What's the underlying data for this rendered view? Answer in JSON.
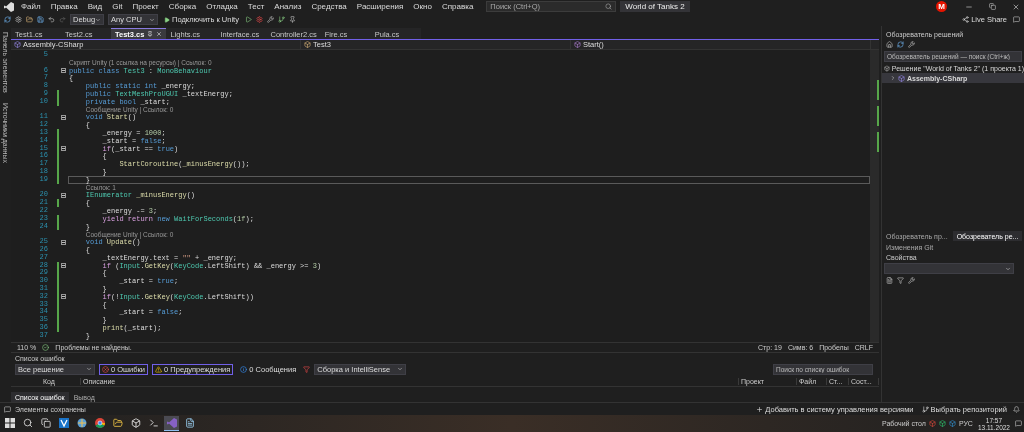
{
  "menu": {
    "items": [
      "Файл",
      "Правка",
      "Вид",
      "Git",
      "Проект",
      "Сборка",
      "Отладка",
      "Тест",
      "Анализ",
      "Средства",
      "Расширения",
      "Окно",
      "Справка"
    ]
  },
  "search": {
    "placeholder": "Поиск (Ctrl+Q)"
  },
  "solution_title": "World of Tanks 2",
  "account": {
    "initial": "M"
  },
  "toolbar": {
    "configuration": "Debug",
    "platform": "Any CPU",
    "run_label": "Подключить к Unity",
    "live_share": "Live Share"
  },
  "side_tabs": [
    "Панель элементов",
    "Источники данных"
  ],
  "tabs": [
    {
      "label": "Test1.cs",
      "selected": false
    },
    {
      "label": "Test2.cs",
      "selected": false
    },
    {
      "label": "Test3.cs",
      "selected": true
    },
    {
      "label": "Lights.cs",
      "selected": false
    },
    {
      "label": "Interface.cs",
      "selected": false
    },
    {
      "label": "Controller2.cs",
      "selected": false
    },
    {
      "label": "Fire.cs",
      "selected": false
    },
    {
      "label": "Pula.cs",
      "selected": false
    }
  ],
  "nav": {
    "project": "Assembly-CSharp",
    "type": "Test3",
    "member": "Start()"
  },
  "editor": {
    "lines": [
      {
        "kind": "code",
        "number": "5",
        "changed": false,
        "fold": false,
        "current": false
      },
      {
        "kind": "lens",
        "text": "Скрипт Unity (1 ссылка на ресурсы) | Ссылок: 0"
      },
      {
        "kind": "code",
        "number": "6",
        "changed": false,
        "fold": true,
        "current": false,
        "tokens": [
          {
            "kind": "kw",
            "text": "public class "
          },
          {
            "kind": "type",
            "text": "Test3"
          },
          {
            "kind": "plain",
            "text": " : "
          },
          {
            "kind": "type",
            "text": "MonoBehaviour"
          }
        ]
      },
      {
        "kind": "code",
        "number": "7",
        "changed": false,
        "fold": false,
        "current": false,
        "tokens": [
          {
            "kind": "plain",
            "text": "{"
          }
        ]
      },
      {
        "kind": "code",
        "number": "8",
        "changed": false,
        "fold": false,
        "current": false,
        "tokens": [
          {
            "kind": "kw",
            "text": "    public static int "
          },
          {
            "kind": "plain",
            "text": "_energy;"
          }
        ]
      },
      {
        "kind": "code",
        "number": "9",
        "changed": true,
        "fold": false,
        "current": false,
        "tokens": [
          {
            "kind": "kw",
            "text": "    public "
          },
          {
            "kind": "type",
            "text": "TextMeshProUGUI"
          },
          {
            "kind": "plain",
            "text": " _textEnergy;"
          }
        ]
      },
      {
        "kind": "code",
        "number": "10",
        "changed": true,
        "fold": false,
        "current": false,
        "tokens": [
          {
            "kind": "kw",
            "text": "    private bool "
          },
          {
            "kind": "plain",
            "text": "_start;"
          }
        ]
      },
      {
        "kind": "lens",
        "text": "Сообщение Unity | Ссылок: 0"
      },
      {
        "kind": "code",
        "number": "11",
        "changed": false,
        "fold": true,
        "current": false,
        "tokens": [
          {
            "kind": "kw",
            "text": "    void "
          },
          {
            "kind": "method",
            "text": "Start"
          },
          {
            "kind": "plain",
            "text": "()"
          }
        ]
      },
      {
        "kind": "code",
        "number": "12",
        "changed": false,
        "fold": false,
        "current": false,
        "tokens": [
          {
            "kind": "plain",
            "text": "    {"
          }
        ]
      },
      {
        "kind": "code",
        "number": "13",
        "changed": true,
        "fold": false,
        "current": false,
        "tokens": [
          {
            "kind": "plain",
            "text": "        _energy = "
          },
          {
            "kind": "num",
            "text": "1000"
          },
          {
            "kind": "plain",
            "text": ";"
          }
        ]
      },
      {
        "kind": "code",
        "number": "14",
        "changed": true,
        "fold": false,
        "current": false,
        "tokens": [
          {
            "kind": "plain",
            "text": "        _start = "
          },
          {
            "kind": "kw",
            "text": "false"
          },
          {
            "kind": "plain",
            "text": ";"
          }
        ]
      },
      {
        "kind": "code",
        "number": "15",
        "changed": true,
        "fold": true,
        "current": false,
        "tokens": [
          {
            "kind": "ctrl",
            "text": "        if"
          },
          {
            "kind": "plain",
            "text": "(_start == "
          },
          {
            "kind": "kw",
            "text": "true"
          },
          {
            "kind": "plain",
            "text": ")"
          }
        ]
      },
      {
        "kind": "code",
        "number": "16",
        "changed": true,
        "fold": false,
        "current": false,
        "tokens": [
          {
            "kind": "plain",
            "text": "        {"
          }
        ]
      },
      {
        "kind": "code",
        "number": "17",
        "changed": true,
        "fold": false,
        "current": false,
        "tokens": [
          {
            "kind": "method",
            "text": "            StartCoroutine"
          },
          {
            "kind": "plain",
            "text": "("
          },
          {
            "kind": "method",
            "text": "_minusEnergy"
          },
          {
            "kind": "plain",
            "text": "());"
          }
        ]
      },
      {
        "kind": "code",
        "number": "18",
        "changed": true,
        "fold": false,
        "current": false,
        "tokens": [
          {
            "kind": "plain",
            "text": "        }"
          }
        ]
      },
      {
        "kind": "code",
        "number": "19",
        "changed": true,
        "fold": false,
        "current": true,
        "tokens": [
          {
            "kind": "plain",
            "text": "    }"
          }
        ]
      },
      {
        "kind": "lens",
        "text": "Ссылок: 1"
      },
      {
        "kind": "code",
        "number": "20",
        "changed": false,
        "fold": true,
        "current": false,
        "tokens": [
          {
            "kind": "type",
            "text": "    IEnumerator"
          },
          {
            "kind": "method",
            "text": " _minusEnergy"
          },
          {
            "kind": "plain",
            "text": "()"
          }
        ]
      },
      {
        "kind": "code",
        "number": "21",
        "changed": true,
        "fold": false,
        "current": false,
        "tokens": [
          {
            "kind": "plain",
            "text": "    {"
          }
        ]
      },
      {
        "kind": "code",
        "number": "22",
        "changed": false,
        "fold": false,
        "current": false,
        "tokens": [
          {
            "kind": "plain",
            "text": "        _energy -= "
          },
          {
            "kind": "num",
            "text": "3"
          },
          {
            "kind": "plain",
            "text": ";"
          }
        ]
      },
      {
        "kind": "code",
        "number": "23",
        "changed": true,
        "fold": false,
        "current": false,
        "tokens": [
          {
            "kind": "ctrl",
            "text": "        yield return "
          },
          {
            "kind": "kw",
            "text": "new "
          },
          {
            "kind": "type",
            "text": "WaitForSeconds"
          },
          {
            "kind": "plain",
            "text": "("
          },
          {
            "kind": "num",
            "text": "1f"
          },
          {
            "kind": "plain",
            "text": ");"
          }
        ]
      },
      {
        "kind": "code",
        "number": "24",
        "changed": true,
        "fold": false,
        "current": false,
        "tokens": [
          {
            "kind": "plain",
            "text": "    }"
          }
        ]
      },
      {
        "kind": "lens",
        "text": "Сообщение Unity | Ссылок: 0"
      },
      {
        "kind": "code",
        "number": "25",
        "changed": false,
        "fold": true,
        "current": false,
        "tokens": [
          {
            "kind": "kw",
            "text": "    void "
          },
          {
            "kind": "method",
            "text": "Update"
          },
          {
            "kind": "plain",
            "text": "()"
          }
        ]
      },
      {
        "kind": "code",
        "number": "26",
        "changed": false,
        "fold": false,
        "current": false,
        "tokens": [
          {
            "kind": "plain",
            "text": "    {"
          }
        ]
      },
      {
        "kind": "code",
        "number": "27",
        "changed": false,
        "fold": false,
        "current": false,
        "tokens": [
          {
            "kind": "plain",
            "text": "        _textEnergy.text = "
          },
          {
            "kind": "str",
            "text": "\"\""
          },
          {
            "kind": "plain",
            "text": " + _energy;"
          }
        ]
      },
      {
        "kind": "code",
        "number": "28",
        "changed": true,
        "fold": true,
        "current": false,
        "tokens": [
          {
            "kind": "ctrl",
            "text": "        if"
          },
          {
            "kind": "plain",
            "text": " ("
          },
          {
            "kind": "type",
            "text": "Input"
          },
          {
            "kind": "plain",
            "text": "."
          },
          {
            "kind": "method",
            "text": "GetKey"
          },
          {
            "kind": "plain",
            "text": "("
          },
          {
            "kind": "type",
            "text": "KeyCode"
          },
          {
            "kind": "plain",
            "text": ".LeftShift) && _energy >= "
          },
          {
            "kind": "num",
            "text": "3"
          },
          {
            "kind": "plain",
            "text": ")"
          }
        ]
      },
      {
        "kind": "code",
        "number": "29",
        "changed": true,
        "fold": false,
        "current": false,
        "tokens": [
          {
            "kind": "plain",
            "text": "        {"
          }
        ]
      },
      {
        "kind": "code",
        "number": "30",
        "changed": true,
        "fold": false,
        "current": false,
        "tokens": [
          {
            "kind": "plain",
            "text": "            _start = "
          },
          {
            "kind": "kw",
            "text": "true"
          },
          {
            "kind": "plain",
            "text": ";"
          }
        ]
      },
      {
        "kind": "code",
        "number": "31",
        "changed": true,
        "fold": false,
        "current": false,
        "tokens": [
          {
            "kind": "plain",
            "text": "        }"
          }
        ]
      },
      {
        "kind": "code",
        "number": "32",
        "changed": true,
        "fold": true,
        "current": false,
        "tokens": [
          {
            "kind": "ctrl",
            "text": "        if"
          },
          {
            "kind": "plain",
            "text": "(!"
          },
          {
            "kind": "type",
            "text": "Input"
          },
          {
            "kind": "plain",
            "text": "."
          },
          {
            "kind": "method",
            "text": "GetKey"
          },
          {
            "kind": "plain",
            "text": "("
          },
          {
            "kind": "type",
            "text": "KeyCode"
          },
          {
            "kind": "plain",
            "text": ".LeftShift))"
          }
        ]
      },
      {
        "kind": "code",
        "number": "33",
        "changed": true,
        "fold": false,
        "current": false,
        "tokens": [
          {
            "kind": "plain",
            "text": "        {"
          }
        ]
      },
      {
        "kind": "code",
        "number": "34",
        "changed": true,
        "fold": false,
        "current": false,
        "tokens": [
          {
            "kind": "plain",
            "text": "            _start = "
          },
          {
            "kind": "kw",
            "text": "false"
          },
          {
            "kind": "plain",
            "text": ";"
          }
        ]
      },
      {
        "kind": "code",
        "number": "35",
        "changed": true,
        "fold": false,
        "current": false,
        "tokens": [
          {
            "kind": "plain",
            "text": "        }"
          }
        ]
      },
      {
        "kind": "code",
        "number": "36",
        "changed": true,
        "fold": false,
        "current": false,
        "tokens": [
          {
            "kind": "method",
            "text": "        print"
          },
          {
            "kind": "plain",
            "text": "(_start);"
          }
        ]
      },
      {
        "kind": "code",
        "number": "37",
        "changed": false,
        "fold": false,
        "current": false,
        "tokens": [
          {
            "kind": "plain",
            "text": "    }"
          }
        ]
      }
    ]
  },
  "editor_status": {
    "zoom": "110 %",
    "issues": "Проблемы не найдены.",
    "line": "Стр: 19",
    "column": "Симв: 6",
    "whitespace": "Пробелы",
    "line_ending": "CRLF"
  },
  "error_list": {
    "title": "Список ошибок",
    "scope": "Все решение",
    "filters": [
      {
        "kind": "error",
        "label": "0 Ошибки",
        "selected": true
      },
      {
        "kind": "warning",
        "label": "0 Предупреждения",
        "selected": true
      },
      {
        "kind": "info",
        "label": "0 Сообщения",
        "selected": false
      }
    ],
    "source": "Сборка и IntelliSense",
    "search": {
      "placeholder": "Поиск по списку ошибок"
    },
    "columns": [
      "Код",
      "Описание",
      "Проект",
      "Файл",
      "Ст...",
      "Сост..."
    ],
    "tabs": [
      {
        "label": "Список ошибок",
        "selected": true
      },
      {
        "label": "Вывод",
        "selected": false
      }
    ]
  },
  "solution_explorer": {
    "title": "Обозреватель решений",
    "search": {
      "placeholder": "Обозреватель решений — поиск (Ctrl+ж)"
    },
    "tree": [
      {
        "label": "Решение \"World of Tanks 2\" (1 проекта 1)",
        "selected": false,
        "children": [
          {
            "label": "Assembly-CSharp",
            "expanded": false,
            "selected": true
          }
        ]
      }
    ],
    "tabs": [
      {
        "label": "Обозреватель пр...",
        "selected": false
      },
      {
        "label": "Обозреватель ре...",
        "selected": true
      },
      {
        "label": "Изменения Git",
        "selected": false
      }
    ]
  },
  "properties": {
    "title": "Свойства"
  },
  "status_bar": {
    "message": "Элементы сохранены",
    "source_control": "Добавить в систему управления версиями",
    "repository": "Выбрать репозиторий"
  },
  "taskbar": {
    "apps": [
      {
        "kind": "start",
        "active": false
      },
      {
        "kind": "search",
        "active": false
      },
      {
        "kind": "taskview",
        "active": false
      },
      {
        "kind": "editor",
        "active": false
      },
      {
        "kind": "weather",
        "active": false
      },
      {
        "kind": "browser",
        "active": false
      },
      {
        "kind": "folder",
        "active": false
      },
      {
        "kind": "unity",
        "active": false
      },
      {
        "kind": "terminal",
        "active": false
      },
      {
        "kind": "studio",
        "active": true
      },
      {
        "kind": "notepad",
        "active": false
      }
    ],
    "desktop_label": "Рабочий стол",
    "language": "РУС",
    "time": "17:57",
    "date": "13.11.2022"
  }
}
